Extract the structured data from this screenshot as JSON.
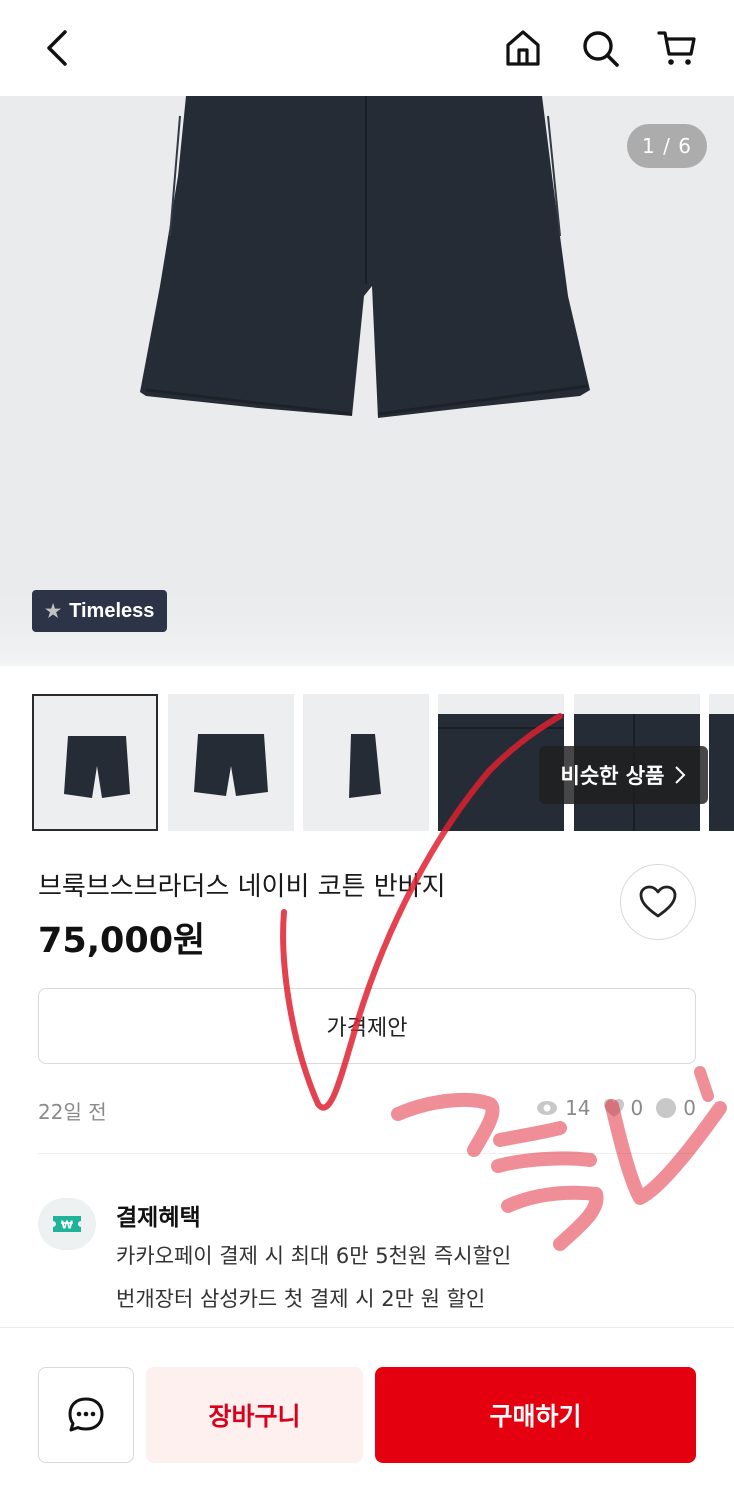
{
  "header": {
    "back_icon": "chevron-left-icon",
    "home_icon": "home-icon",
    "search_icon": "search-icon",
    "cart_icon": "cart-icon"
  },
  "gallery": {
    "counter": "1 / 6",
    "badge_label": "Timeless",
    "similar_label": "비슷한 상품",
    "thumbnail_count": 6
  },
  "product": {
    "title": "브룩브스브라더스 네이비 코튼 반바지",
    "price": "75,000원",
    "offer_button": "가격제안",
    "time_ago": "22일 전",
    "views": "14",
    "likes": "0",
    "comments": "0"
  },
  "payment_benefits": {
    "title": "결제혜택",
    "line1": "카카오페이 결제 시 최대 6만 5천원 즉시할인",
    "line2": "번개장터 삼성카드 첫 결제 시 2만 원  할인"
  },
  "bottom_bar": {
    "add_to_cart": "장바구니",
    "buy_now": "구매하기"
  },
  "colors": {
    "accent_red": "#e4000f",
    "cart_bg": "#fdf0ef",
    "badge_bg": "#2d3448",
    "scribble": "#e02030"
  }
}
